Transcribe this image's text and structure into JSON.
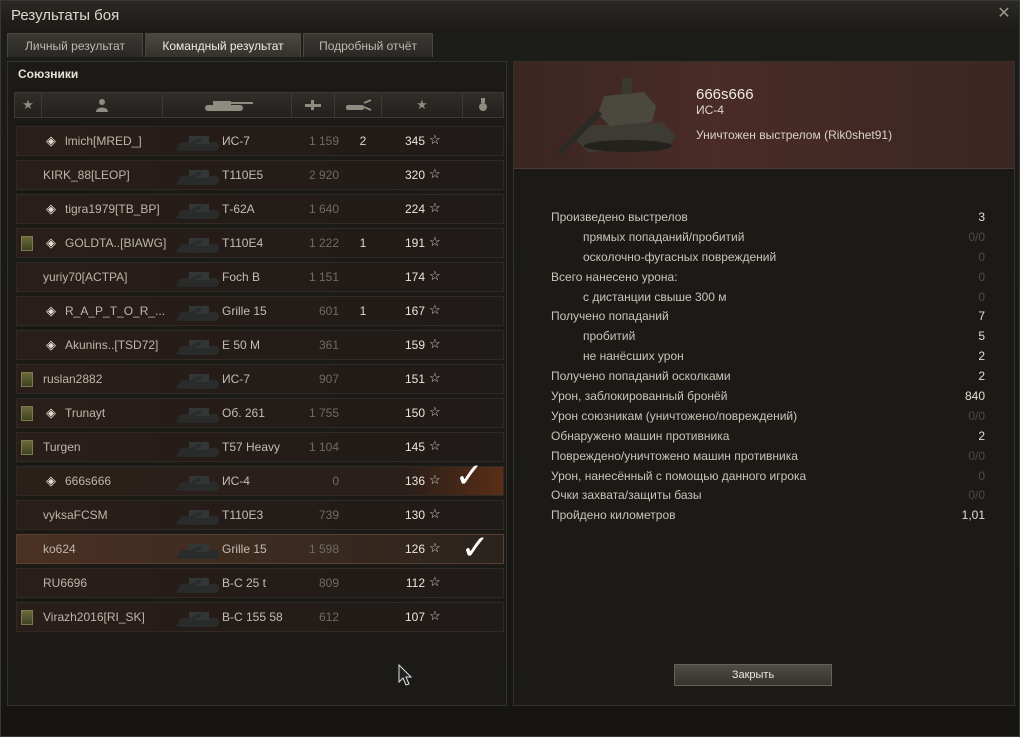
{
  "window": {
    "title": "Результаты боя",
    "close_icon": "close-icon"
  },
  "tabs": [
    {
      "label": "Личный результат",
      "active": false
    },
    {
      "label": "Командный результат",
      "active": true
    },
    {
      "label": "Подробный отчёт",
      "active": false
    }
  ],
  "left": {
    "section_title": "Союзники",
    "header_icons": [
      "star-filter-icon",
      "player-icon",
      "tank-icon",
      "damage-icon",
      "kills-icon",
      "experience-icon",
      "medal-icon"
    ],
    "rows": [
      {
        "badge": false,
        "clan": true,
        "name": "lmich[MRED_]",
        "tank": "ИС-7",
        "damage": "1 159",
        "kills": "2",
        "xp": "345"
      },
      {
        "badge": false,
        "clan": false,
        "name": "KIRK_88[LEOP]",
        "tank": "T110E5",
        "damage": "2 920",
        "kills": "",
        "xp": "320"
      },
      {
        "badge": false,
        "clan": true,
        "name": "tigra1979[TB_BP]",
        "tank": "Т-62А",
        "damage": "1 640",
        "kills": "",
        "xp": "224"
      },
      {
        "badge": true,
        "clan": true,
        "name": "GOLDTA..[BIAWG]",
        "tank": "T110E4",
        "damage": "1 222",
        "kills": "1",
        "xp": "191"
      },
      {
        "badge": false,
        "clan": false,
        "name": "yuriy70[ACTPA]",
        "tank": "Foch B",
        "damage": "1 151",
        "kills": "",
        "xp": "174"
      },
      {
        "badge": false,
        "clan": true,
        "name": "R_A_P_T_O_R_...",
        "tank": "Grille 15",
        "damage": "601",
        "kills": "1",
        "xp": "167"
      },
      {
        "badge": false,
        "clan": true,
        "name": "Akunins..[TSD72]",
        "tank": "E 50 M",
        "damage": "361",
        "kills": "",
        "xp": "159"
      },
      {
        "badge": true,
        "clan": false,
        "name": "ruslan2882",
        "tank": "ИС-7",
        "damage": "907",
        "kills": "",
        "xp": "151"
      },
      {
        "badge": true,
        "clan": true,
        "name": "Trunayt",
        "tank": "Об. 261",
        "damage": "1 755",
        "kills": "",
        "xp": "150"
      },
      {
        "badge": true,
        "clan": false,
        "name": "Turgen",
        "tank": "T57 Heavy",
        "damage": "1 104",
        "kills": "",
        "xp": "145"
      },
      {
        "badge": false,
        "clan": true,
        "name": "666s666",
        "tank": "ИС-4",
        "damage": "0",
        "kills": "",
        "xp": "136"
      },
      {
        "badge": false,
        "clan": false,
        "name": "vyksaFCSM",
        "tank": "T110E3",
        "damage": "739",
        "kills": "",
        "xp": "130"
      },
      {
        "badge": false,
        "clan": false,
        "name": "ko624",
        "tank": "Grille 15",
        "damage": "1 598",
        "kills": "",
        "xp": "126"
      },
      {
        "badge": false,
        "clan": false,
        "name": "RU6696",
        "tank": "B-C 25 t",
        "damage": "809",
        "kills": "",
        "xp": "112"
      },
      {
        "badge": true,
        "clan": false,
        "name": "Virazh2016[RI_SK]",
        "tank": "B-C 155 58",
        "damage": "612",
        "kills": "",
        "xp": "107"
      }
    ]
  },
  "right": {
    "player_name": "666s666",
    "player_tank": "ИС-4",
    "killed_by": "Уничтожен выстрелом (Rik0shet91)",
    "stats": [
      {
        "label": "Произведено выстрелов",
        "value": "3",
        "indent": false,
        "dim": false
      },
      {
        "label": "прямых попаданий/пробитий",
        "value": "0/0",
        "indent": true,
        "dim": true
      },
      {
        "label": "осколочно-фугасных повреждений",
        "value": "0",
        "indent": true,
        "dim": true
      },
      {
        "label": "Всего нанесено урона:",
        "value": "0",
        "indent": false,
        "dim": true
      },
      {
        "label": "с дистанции свыше 300 м",
        "value": "0",
        "indent": true,
        "dim": true
      },
      {
        "label": "Получено попаданий",
        "value": "7",
        "indent": false,
        "dim": false
      },
      {
        "label": "пробитий",
        "value": "5",
        "indent": true,
        "dim": false
      },
      {
        "label": "не нанёсших урон",
        "value": "2",
        "indent": true,
        "dim": false
      },
      {
        "label": "Получено попаданий осколками",
        "value": "2",
        "indent": false,
        "dim": false
      },
      {
        "label": "Урон, заблокированный бронёй",
        "value": "840",
        "indent": false,
        "dim": false
      },
      {
        "label": "Урон союзникам (уничтожено/повреждений)",
        "value": "0/0",
        "indent": false,
        "dim": true
      },
      {
        "label": "Обнаружено машин противника",
        "value": "2",
        "indent": false,
        "dim": false
      },
      {
        "label": "Повреждено/уничтожено машин противника",
        "value": "0/0",
        "indent": false,
        "dim": true
      },
      {
        "label": "Урон, нанесённый с помощью данного игрока",
        "value": "0",
        "indent": false,
        "dim": true
      },
      {
        "label": "Очки захвата/защиты базы",
        "value": "0/0",
        "indent": false,
        "dim": true
      },
      {
        "label": "Пройдено километров",
        "value": "1,01",
        "indent": false,
        "dim": false
      }
    ],
    "close_label": "Закрыть"
  }
}
